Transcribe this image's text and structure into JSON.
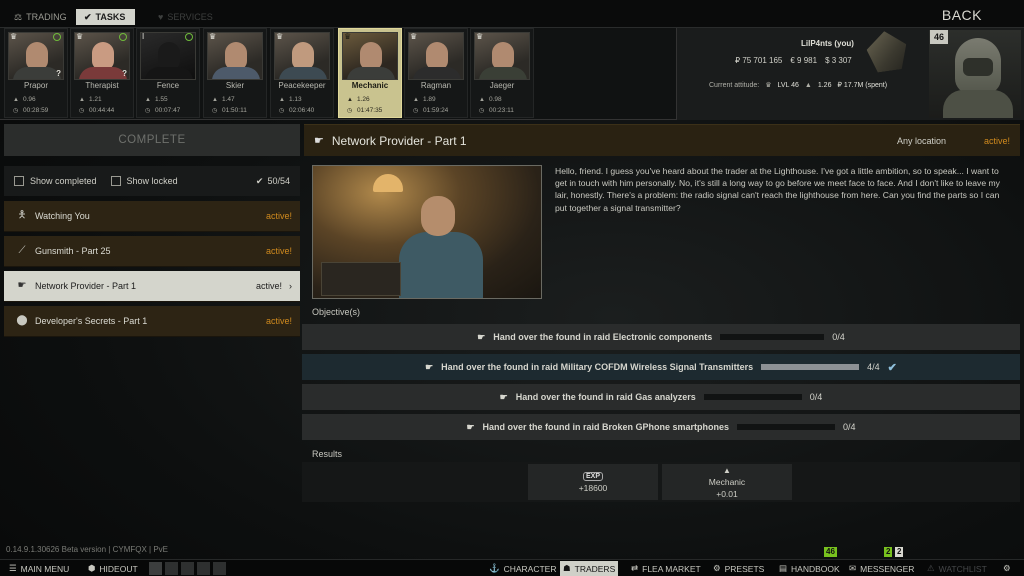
{
  "topnav": {
    "tabs": [
      {
        "label": "TRADING",
        "icon": "scales-icon"
      },
      {
        "label": "TASKS",
        "icon": "check-circle-icon"
      },
      {
        "label": "SERVICES",
        "icon": "handshake-icon"
      }
    ],
    "back_label": "BACK"
  },
  "traders": [
    {
      "name": "Prapor",
      "rep": "0.96",
      "timer": "00:28:59"
    },
    {
      "name": "Therapist",
      "rep": "1.21",
      "timer": "00:44:44"
    },
    {
      "name": "Fence",
      "rep": "1.55",
      "timer": "00:07:47",
      "badge": "I"
    },
    {
      "name": "Skier",
      "rep": "1.47",
      "timer": "01:50:11"
    },
    {
      "name": "Peacekeeper",
      "rep": "1.13",
      "timer": "02:06:40"
    },
    {
      "name": "Mechanic",
      "rep": "1.26",
      "timer": "01:47:35"
    },
    {
      "name": "Ragman",
      "rep": "1.89",
      "timer": "01:59:24"
    },
    {
      "name": "Jaeger",
      "rep": "0.98",
      "timer": "00:23:11"
    }
  ],
  "player": {
    "name": "LilP4nts (you)",
    "roubles": "₽ 75 701 165",
    "euros": "€ 9 981",
    "dollars": "$ 3 307",
    "attitude_label": "Current attitude:",
    "lvl": "LVL 46",
    "rep": "1.26",
    "spent": "₽ 17.7M (spent)",
    "level": "46"
  },
  "quests_panel": {
    "complete_label": "COMPLETE",
    "show_completed": "Show completed",
    "show_locked": "Show locked",
    "count": "50/54",
    "quests": [
      {
        "name": "Watching You",
        "status": "active!",
        "icon": "person-icon"
      },
      {
        "name": "Gunsmith - Part 25",
        "status": "active!",
        "icon": "rifle-icon"
      },
      {
        "name": "Network Provider - Part 1",
        "status": "active!",
        "icon": "hand-icon"
      },
      {
        "name": "Developer's Secrets - Part 1",
        "status": "active!",
        "icon": "map-pin-icon"
      }
    ]
  },
  "detail": {
    "title": "Network Provider - Part 1",
    "location": "Any location",
    "status": "active!",
    "description": "Hello, friend. I guess you've heard about the trader at the Lighthouse. I've got a little ambition, so to speak... I want to get in touch with him personally. No, it's still a long way to go before we meet face to face. And I don't like to leave my lair, honestly. There's a problem: the radio signal can't reach the lighthouse from here. Can you find the parts so I can put together a signal transmitter?",
    "objectives_label": "Objective(s)",
    "objectives": [
      {
        "text": "Hand over the found in raid Electronic components",
        "count": "0/4",
        "progress": 0
      },
      {
        "text": "Hand over the found in raid Military COFDM Wireless Signal Transmitters",
        "count": "4/4",
        "progress": 1
      },
      {
        "text": "Hand over the found in raid Gas analyzers",
        "count": "0/4",
        "progress": 0
      },
      {
        "text": "Hand over the found in raid Broken GPhone smartphones",
        "count": "0/4",
        "progress": 0
      }
    ],
    "results_label": "Results",
    "rewards": [
      {
        "label": "EXP",
        "value": "+18600"
      },
      {
        "label": "Mechanic",
        "value": "+0.01"
      }
    ]
  },
  "version": "0.14.9.1.30626 Beta version | CYMFQX | PvE",
  "bottombar": {
    "main_menu": "MAIN MENU",
    "hideout": "HIDEOUT",
    "character": "CHARACTER",
    "traders": "TRADERS",
    "flea_market": "FLEA MARKET",
    "presets": "PRESETS",
    "handbook": "HANDBOOK",
    "messenger": "MESSENGER",
    "watchlist": "WATCHLIST",
    "handbook_badge": "46",
    "messenger_badge_a": "2",
    "messenger_badge_b": "2"
  },
  "colors": {
    "active_status": "#d08a1e",
    "selected_bg": "#d4d5cc",
    "quest_bg": "#2d2414",
    "badge_green": "#78c21e"
  }
}
